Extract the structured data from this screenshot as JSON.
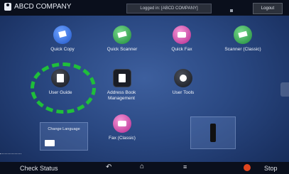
{
  "topbar": {
    "company": "ABCD COMPANY",
    "logged_in": "Logged in: [ABCD COMPANY]",
    "logout": "Logout"
  },
  "apps": [
    {
      "label": "Quick Copy",
      "icon": "copy-icon"
    },
    {
      "label": "Quick Scanner",
      "icon": "scanner-icon"
    },
    {
      "label": "Quick Fax",
      "icon": "fax-icon"
    },
    {
      "label": "Scanner (Classic)",
      "icon": "scanner-classic-icon"
    },
    {
      "label": "User Guide",
      "icon": "user-guide-icon"
    },
    {
      "label": "Address Book Management",
      "icon": "address-book-icon"
    },
    {
      "label": "User Tools",
      "icon": "user-tools-icon"
    },
    {
      "label": "Fax (Classic)",
      "icon": "fax-classic-icon"
    }
  ],
  "widgets": {
    "change_language": "Change Language"
  },
  "bottombar": {
    "check_status": "Check Status",
    "stop": "Stop"
  }
}
